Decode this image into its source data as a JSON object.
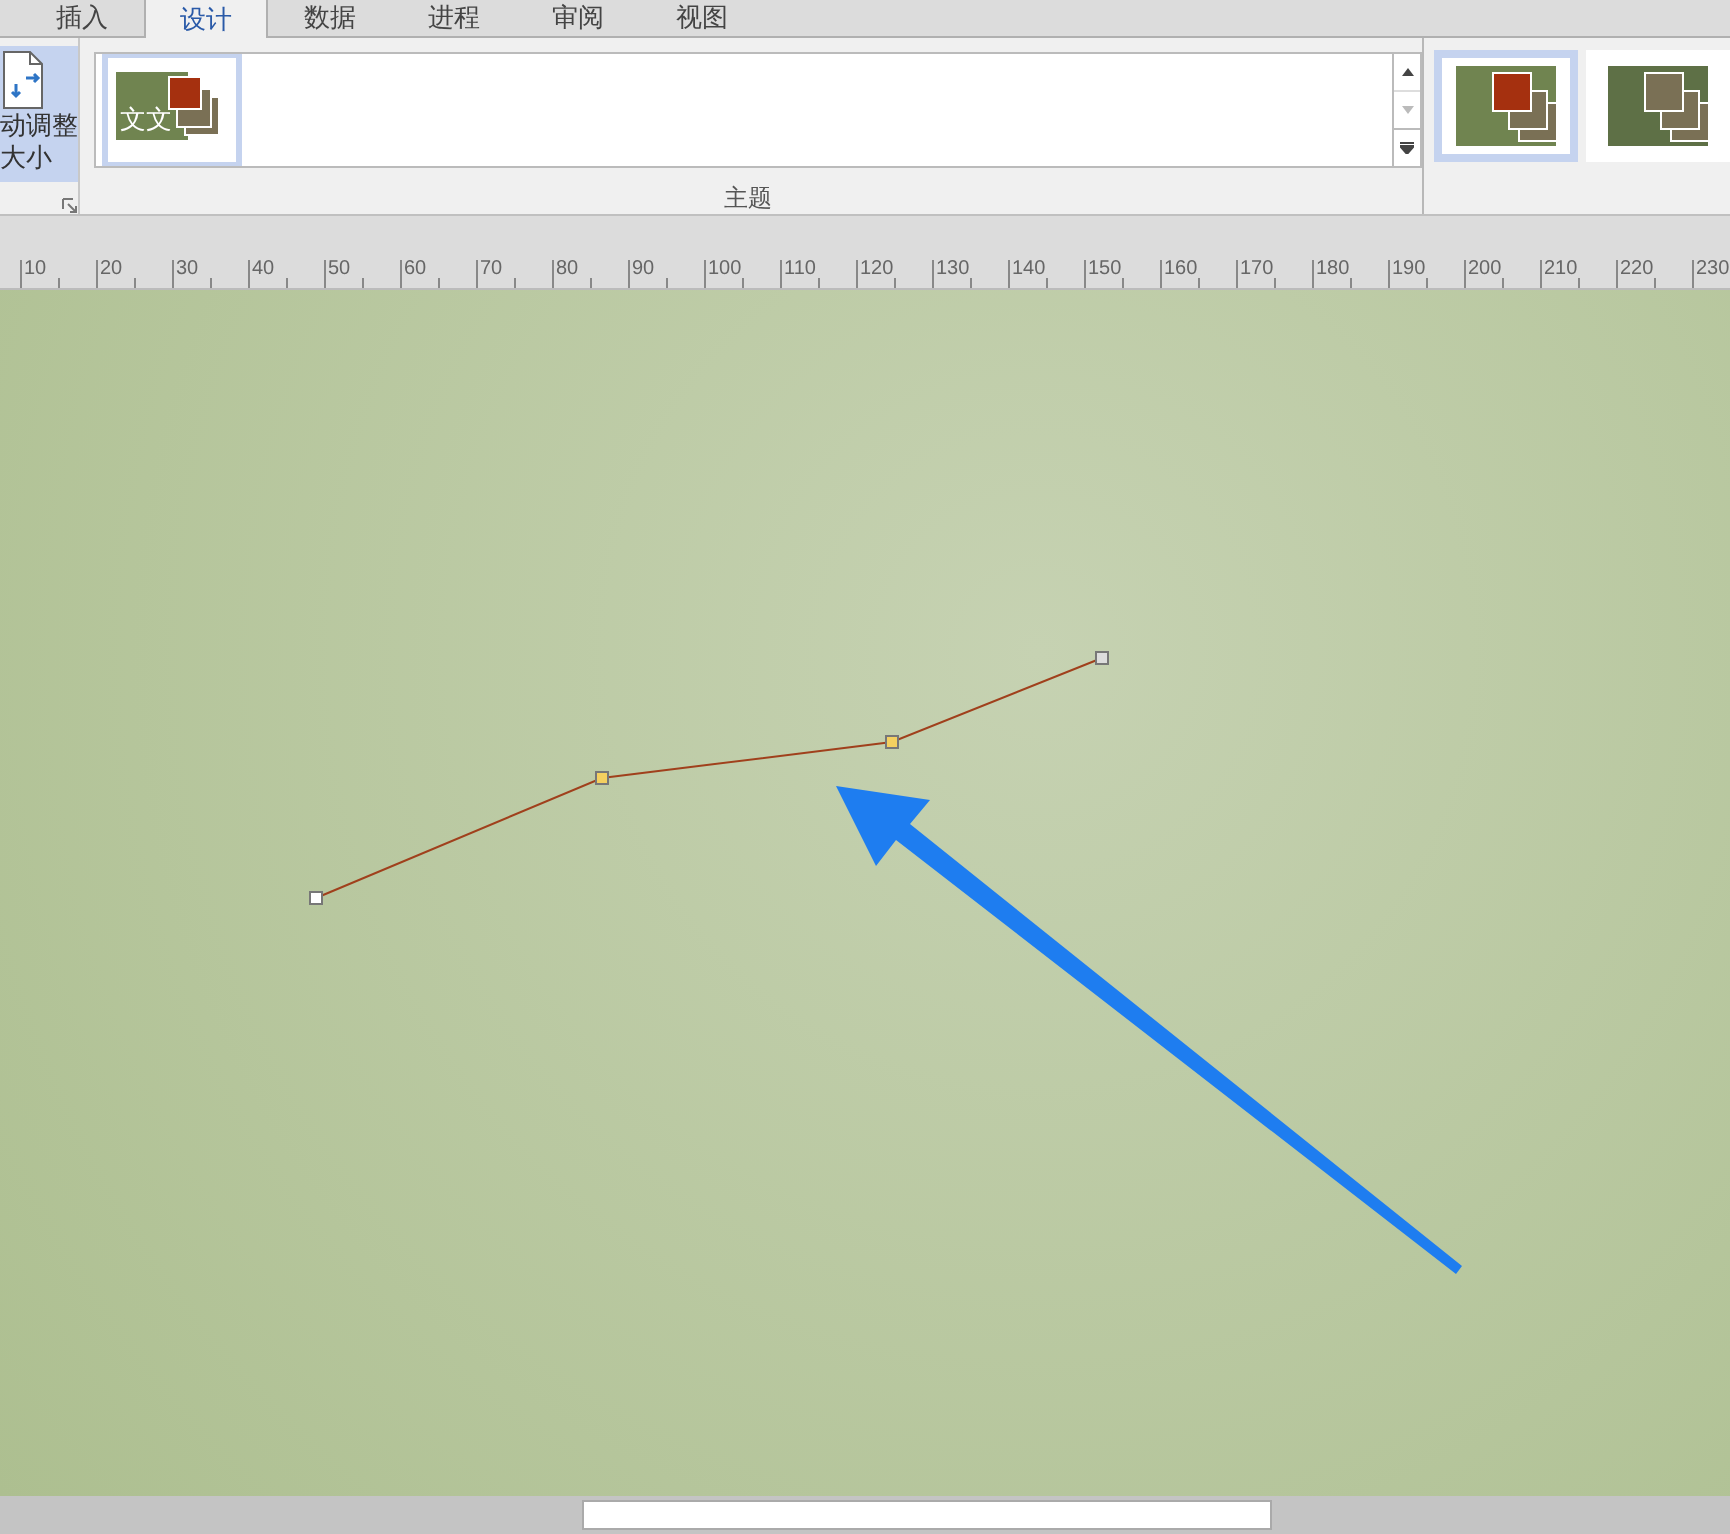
{
  "tabs": [
    {
      "label": "插入",
      "selected": false
    },
    {
      "label": "设计",
      "selected": true
    },
    {
      "label": "数据",
      "selected": false
    },
    {
      "label": "进程",
      "selected": false
    },
    {
      "label": "审阅",
      "selected": false
    },
    {
      "label": "视图",
      "selected": false
    }
  ],
  "ribbon": {
    "auto_size_button": {
      "label": "动调整大小",
      "selected": true
    },
    "theme_group": {
      "label": "主题",
      "themes": [
        {
          "label": "文文",
          "selected": true
        }
      ]
    },
    "variants": [
      {
        "selected": true,
        "color": "#a5300f"
      },
      {
        "selected": false,
        "color": "#7a7055"
      }
    ]
  },
  "ruler": {
    "labels": [
      "10",
      "20",
      "30",
      "40",
      "50",
      "60",
      "70",
      "80",
      "90",
      "100",
      "110",
      "120",
      "130",
      "140",
      "150",
      "160",
      "170",
      "180",
      "190",
      "200",
      "210",
      "220",
      "230"
    ]
  }
}
